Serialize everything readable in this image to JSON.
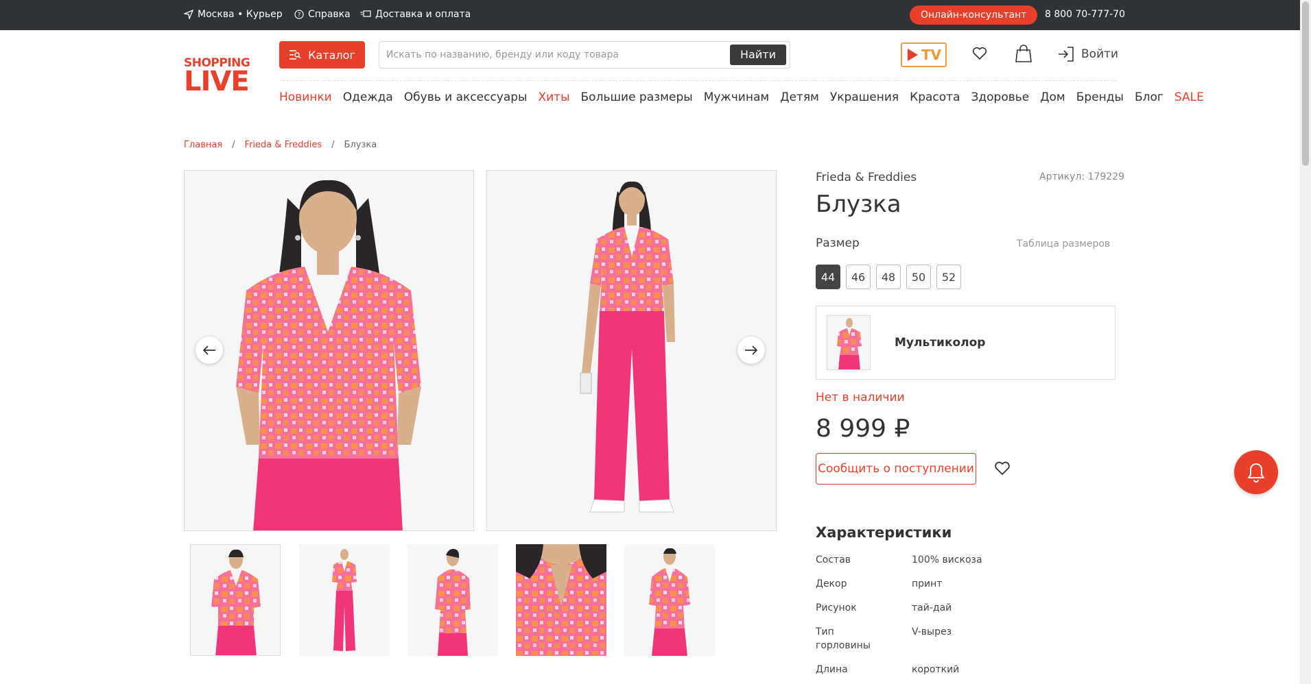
{
  "topbar": {
    "location": "Москва • Курьер",
    "help": "Справка",
    "delivery": "Доставка и оплата",
    "consultant": "Онлайн-консультант",
    "phone": "8 800 70-777-70"
  },
  "header": {
    "logo_top": "SHOPPING",
    "logo_bottom": "LIVE",
    "catalog": "Каталог",
    "search_placeholder": "Искать по названию, бренду или коду товара",
    "search_button": "Найти",
    "tv_label": "TV",
    "login": "Войти"
  },
  "nav": [
    {
      "label": "Новинки",
      "highlight": true
    },
    {
      "label": "Одежда",
      "highlight": false
    },
    {
      "label": "Обувь и аксессуары",
      "highlight": false
    },
    {
      "label": "Хиты",
      "highlight": true
    },
    {
      "label": "Большие размеры",
      "highlight": false
    },
    {
      "label": "Мужчинам",
      "highlight": false
    },
    {
      "label": "Детям",
      "highlight": false
    },
    {
      "label": "Украшения",
      "highlight": false
    },
    {
      "label": "Красота",
      "highlight": false
    },
    {
      "label": "Здоровье",
      "highlight": false
    },
    {
      "label": "Дом",
      "highlight": false
    },
    {
      "label": "Бренды",
      "highlight": false
    },
    {
      "label": "Блог",
      "highlight": false
    },
    {
      "label": "SALE",
      "highlight": true
    }
  ],
  "breadcrumb": {
    "home": "Главная",
    "sep": "/",
    "brand": "Frieda & Freddies",
    "current": "Блузка"
  },
  "product": {
    "brand": "Frieda & Freddies",
    "article": "Артикул: 179229",
    "title": "Блузка",
    "size_label": "Размер",
    "size_table": "Таблица размеров",
    "sizes": [
      "44",
      "46",
      "48",
      "50",
      "52"
    ],
    "selected_size": "44",
    "color": "Мультиколор",
    "stock": "Нет в наличии",
    "price": "8 999 ₽",
    "notify": "Сообщить о поступлении"
  },
  "characteristics": {
    "title": "Характеристики",
    "rows": [
      {
        "key": "Состав",
        "value": "100% вискоза"
      },
      {
        "key": "Декор",
        "value": "принт"
      },
      {
        "key": "Рисунок",
        "value": "тай-дай"
      },
      {
        "key": "Тип горловины",
        "value": "V-вырез"
      },
      {
        "key": "Длина",
        "value": "короткий"
      }
    ]
  },
  "colors": {
    "accent": "#e8402a",
    "topbar": "#303336",
    "tv": "#f29a36",
    "blouse_pink": "#f6709a",
    "blouse_orange": "#f7963e",
    "pants": "#f0357a"
  }
}
